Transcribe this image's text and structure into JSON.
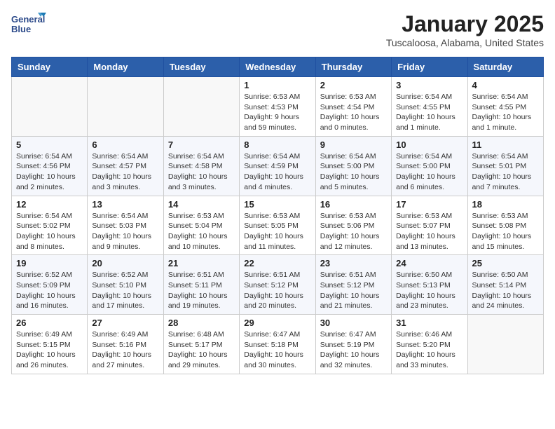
{
  "header": {
    "logo_line1": "General",
    "logo_line2": "Blue",
    "month_title": "January 2025",
    "location": "Tuscaloosa, Alabama, United States"
  },
  "weekdays": [
    "Sunday",
    "Monday",
    "Tuesday",
    "Wednesday",
    "Thursday",
    "Friday",
    "Saturday"
  ],
  "weeks": [
    [
      {
        "day": "",
        "info": ""
      },
      {
        "day": "",
        "info": ""
      },
      {
        "day": "",
        "info": ""
      },
      {
        "day": "1",
        "info": "Sunrise: 6:53 AM\nSunset: 4:53 PM\nDaylight: 9 hours\nand 59 minutes."
      },
      {
        "day": "2",
        "info": "Sunrise: 6:53 AM\nSunset: 4:54 PM\nDaylight: 10 hours\nand 0 minutes."
      },
      {
        "day": "3",
        "info": "Sunrise: 6:54 AM\nSunset: 4:55 PM\nDaylight: 10 hours\nand 1 minute."
      },
      {
        "day": "4",
        "info": "Sunrise: 6:54 AM\nSunset: 4:55 PM\nDaylight: 10 hours\nand 1 minute."
      }
    ],
    [
      {
        "day": "5",
        "info": "Sunrise: 6:54 AM\nSunset: 4:56 PM\nDaylight: 10 hours\nand 2 minutes."
      },
      {
        "day": "6",
        "info": "Sunrise: 6:54 AM\nSunset: 4:57 PM\nDaylight: 10 hours\nand 3 minutes."
      },
      {
        "day": "7",
        "info": "Sunrise: 6:54 AM\nSunset: 4:58 PM\nDaylight: 10 hours\nand 3 minutes."
      },
      {
        "day": "8",
        "info": "Sunrise: 6:54 AM\nSunset: 4:59 PM\nDaylight: 10 hours\nand 4 minutes."
      },
      {
        "day": "9",
        "info": "Sunrise: 6:54 AM\nSunset: 5:00 PM\nDaylight: 10 hours\nand 5 minutes."
      },
      {
        "day": "10",
        "info": "Sunrise: 6:54 AM\nSunset: 5:00 PM\nDaylight: 10 hours\nand 6 minutes."
      },
      {
        "day": "11",
        "info": "Sunrise: 6:54 AM\nSunset: 5:01 PM\nDaylight: 10 hours\nand 7 minutes."
      }
    ],
    [
      {
        "day": "12",
        "info": "Sunrise: 6:54 AM\nSunset: 5:02 PM\nDaylight: 10 hours\nand 8 minutes."
      },
      {
        "day": "13",
        "info": "Sunrise: 6:54 AM\nSunset: 5:03 PM\nDaylight: 10 hours\nand 9 minutes."
      },
      {
        "day": "14",
        "info": "Sunrise: 6:53 AM\nSunset: 5:04 PM\nDaylight: 10 hours\nand 10 minutes."
      },
      {
        "day": "15",
        "info": "Sunrise: 6:53 AM\nSunset: 5:05 PM\nDaylight: 10 hours\nand 11 minutes."
      },
      {
        "day": "16",
        "info": "Sunrise: 6:53 AM\nSunset: 5:06 PM\nDaylight: 10 hours\nand 12 minutes."
      },
      {
        "day": "17",
        "info": "Sunrise: 6:53 AM\nSunset: 5:07 PM\nDaylight: 10 hours\nand 13 minutes."
      },
      {
        "day": "18",
        "info": "Sunrise: 6:53 AM\nSunset: 5:08 PM\nDaylight: 10 hours\nand 15 minutes."
      }
    ],
    [
      {
        "day": "19",
        "info": "Sunrise: 6:52 AM\nSunset: 5:09 PM\nDaylight: 10 hours\nand 16 minutes."
      },
      {
        "day": "20",
        "info": "Sunrise: 6:52 AM\nSunset: 5:10 PM\nDaylight: 10 hours\nand 17 minutes."
      },
      {
        "day": "21",
        "info": "Sunrise: 6:51 AM\nSunset: 5:11 PM\nDaylight: 10 hours\nand 19 minutes."
      },
      {
        "day": "22",
        "info": "Sunrise: 6:51 AM\nSunset: 5:12 PM\nDaylight: 10 hours\nand 20 minutes."
      },
      {
        "day": "23",
        "info": "Sunrise: 6:51 AM\nSunset: 5:12 PM\nDaylight: 10 hours\nand 21 minutes."
      },
      {
        "day": "24",
        "info": "Sunrise: 6:50 AM\nSunset: 5:13 PM\nDaylight: 10 hours\nand 23 minutes."
      },
      {
        "day": "25",
        "info": "Sunrise: 6:50 AM\nSunset: 5:14 PM\nDaylight: 10 hours\nand 24 minutes."
      }
    ],
    [
      {
        "day": "26",
        "info": "Sunrise: 6:49 AM\nSunset: 5:15 PM\nDaylight: 10 hours\nand 26 minutes."
      },
      {
        "day": "27",
        "info": "Sunrise: 6:49 AM\nSunset: 5:16 PM\nDaylight: 10 hours\nand 27 minutes."
      },
      {
        "day": "28",
        "info": "Sunrise: 6:48 AM\nSunset: 5:17 PM\nDaylight: 10 hours\nand 29 minutes."
      },
      {
        "day": "29",
        "info": "Sunrise: 6:47 AM\nSunset: 5:18 PM\nDaylight: 10 hours\nand 30 minutes."
      },
      {
        "day": "30",
        "info": "Sunrise: 6:47 AM\nSunset: 5:19 PM\nDaylight: 10 hours\nand 32 minutes."
      },
      {
        "day": "31",
        "info": "Sunrise: 6:46 AM\nSunset: 5:20 PM\nDaylight: 10 hours\nand 33 minutes."
      },
      {
        "day": "",
        "info": ""
      }
    ]
  ]
}
